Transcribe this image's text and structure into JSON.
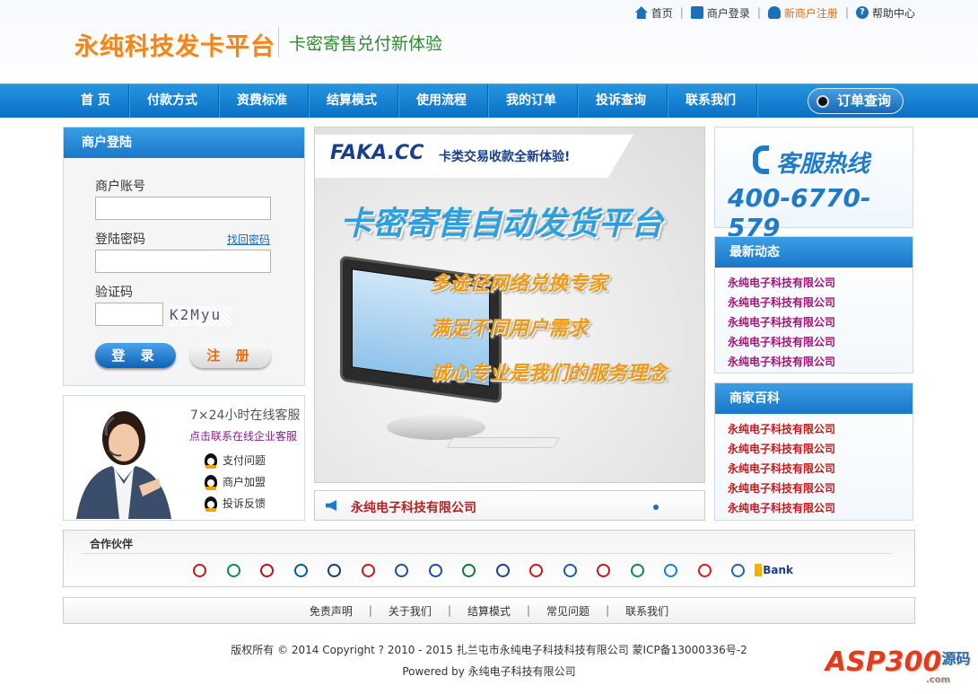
{
  "header": {
    "logo": "永纯科技发卡平台",
    "slogan": "卡密寄售兑付新体验",
    "links": [
      {
        "label": "首页",
        "icon": "home-icon"
      },
      {
        "label": "商户登录",
        "icon": "login-icon"
      },
      {
        "label": "新商户注册",
        "icon": "user-icon"
      },
      {
        "label": "帮助中心",
        "icon": "help-icon"
      }
    ]
  },
  "nav": {
    "items": [
      "首 页",
      "付款方式",
      "资费标准",
      "结算模式",
      "使用流程",
      "我的订单",
      "投诉查询",
      "联系我们"
    ],
    "order_query": "订单查询"
  },
  "login": {
    "title": "商户登陆",
    "account_label": "商户账号",
    "account_value": "",
    "password_label": "登陆密码",
    "password_value": "",
    "forgot": "找回密码",
    "captcha_label": "验证码",
    "captcha_value": "",
    "captcha_image_text": "K2Myu",
    "login_button": "登 录",
    "register_button": "注 册"
  },
  "service": {
    "title": "7×24小时在线客服",
    "link": "点击联系在线企业客服",
    "items": [
      "支付问题",
      "商户加盟",
      "投诉反馈"
    ]
  },
  "banner": {
    "brand": "FAKA.CC",
    "brand_sub": "卡类交易收款全新体验!",
    "headline": "卡密寄售自动发货平台",
    "lines": [
      "多途径网络兑换专家",
      "满足不同用户需求",
      "诚心专业是我们的服务理念"
    ]
  },
  "notice": {
    "text": "永纯电子科技有限公司"
  },
  "hotline": {
    "title": "客服热线",
    "number": "400-6770-579"
  },
  "news": {
    "title": "最新动态",
    "items": [
      "永纯电子科技有限公司",
      "永纯电子科技有限公司",
      "永纯电子科技有限公司",
      "永纯电子科技有限公司",
      "永纯电子科技有限公司"
    ],
    "color": "#a0157a"
  },
  "wiki": {
    "title": "商家百科",
    "items": [
      "永纯电子科技有限公司",
      "永纯电子科技有限公司",
      "永纯电子科技有限公司",
      "永纯电子科技有限公司",
      "永纯电子科技有限公司"
    ],
    "color": "#c11b1b"
  },
  "partners": {
    "title": "合作伙伴",
    "banks": [
      {
        "icon": "icbc-icon",
        "color": "#c8161d"
      },
      {
        "icon": "abc-icon",
        "color": "#0b8a4a"
      },
      {
        "icon": "boc-icon",
        "color": "#b0131b"
      },
      {
        "icon": "ccb-icon",
        "color": "#0a56a6"
      },
      {
        "icon": "bocom-icon",
        "color": "#113a7a"
      },
      {
        "icon": "cmb-icon",
        "color": "#c8161d"
      },
      {
        "icon": "pab-icon",
        "color": "#1d4e9e"
      },
      {
        "icon": "cib-icon",
        "color": "#1a4ea3"
      },
      {
        "icon": "spdb-icon",
        "color": "#0e7a3c"
      },
      {
        "icon": "ceb-icon",
        "color": "#1c3f94"
      },
      {
        "icon": "citic-icon",
        "color": "#c8161d"
      },
      {
        "icon": "cmbc-icon",
        "color": "#1a5aa6"
      },
      {
        "icon": "cgb-icon",
        "color": "#c8161d"
      },
      {
        "icon": "psbc-icon",
        "color": "#0a8a44"
      },
      {
        "icon": "chinamobile-icon",
        "color": "#1283c9"
      },
      {
        "icon": "unicom-icon",
        "color": "#d01c24"
      },
      {
        "icon": "telecom-icon",
        "color": "#1b64b4"
      },
      {
        "icon": "ebank-icon",
        "color": "#1a3f8a",
        "label": "Bank"
      }
    ]
  },
  "footer": {
    "links": [
      "免责声明",
      "关于我们",
      "结算模式",
      "常见问题",
      "联系我们"
    ],
    "copyright": "版权所有 © 2014 Copyright ? 2010 - 2015 扎兰屯市永纯电子科技科技有限公司 蒙ICP备13000336号-2",
    "powered": "Powered by 永纯电子科技有限公司"
  },
  "watermark": {
    "text": "ASP300",
    "sub": "源码",
    "domain": ".com"
  }
}
